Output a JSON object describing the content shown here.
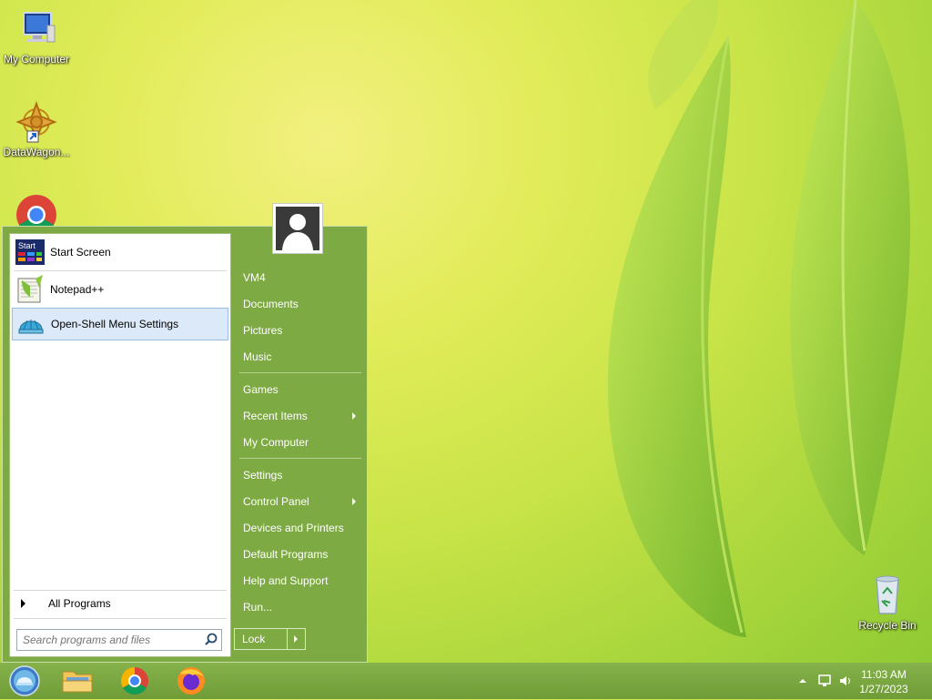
{
  "desktop": {
    "icons": [
      {
        "label": "My Computer"
      },
      {
        "label": "DataWagon..."
      },
      {
        "label": "Recycle Bin"
      }
    ]
  },
  "start_menu": {
    "pinned": [
      {
        "label": "Start Screen",
        "icon_text": "Start"
      },
      {
        "label": "Notepad++"
      },
      {
        "label": "Open-Shell Menu Settings"
      }
    ],
    "all_programs": "All Programs",
    "search_placeholder": "Search programs and files",
    "right_items": [
      {
        "label": "VM4"
      },
      {
        "label": "Documents"
      },
      {
        "label": "Pictures"
      },
      {
        "label": "Music"
      },
      {
        "label": "Games"
      },
      {
        "label": "Recent Items"
      },
      {
        "label": "My Computer"
      },
      {
        "label": "Settings"
      },
      {
        "label": "Control Panel"
      },
      {
        "label": "Devices and Printers"
      },
      {
        "label": "Default Programs"
      },
      {
        "label": "Help and Support"
      },
      {
        "label": "Run..."
      }
    ],
    "lock": "Lock"
  },
  "taskbar": {
    "clock_time": "11:03 AM",
    "clock_date": "1/27/2023"
  },
  "colors": {
    "menu_bg": "#7eaa43",
    "selection": "#dce9f8"
  }
}
